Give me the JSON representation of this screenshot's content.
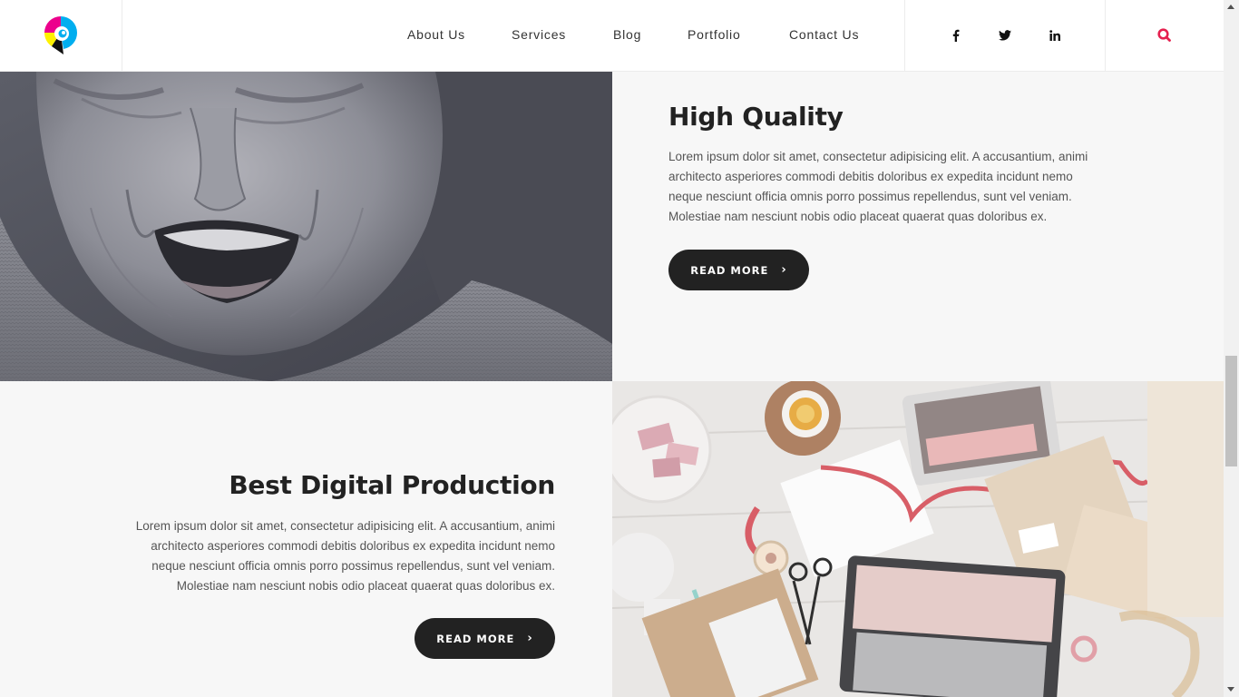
{
  "nav": {
    "items": [
      {
        "label": "About Us"
      },
      {
        "label": "Services"
      },
      {
        "label": "Blog"
      },
      {
        "label": "Portfolio"
      },
      {
        "label": "Contact Us"
      }
    ]
  },
  "social": {
    "facebook": "f",
    "twitter": "twitter-icon",
    "linkedin": "in"
  },
  "accent_color": "#e5204f",
  "sections": {
    "high_quality": {
      "title": "High Quality",
      "line1": "Lorem ipsum dolor sit amet, consectetur adipisicing elit. A accusantium, animi",
      "line2": "architecto asperiores commodi debitis doloribus ex expedita incidunt nemo",
      "line3": "neque nesciunt officia omnis porro possimus repellendus, sunt vel veniam.",
      "line4": "Molestiae nam nesciunt nobis odio placeat quaerat quas doloribus ex.",
      "button": "READ MORE"
    },
    "digital_production": {
      "title": "Best Digital Production",
      "line1": "Lorem ipsum dolor sit amet, consectetur adipisicing elit. A accusantium, animi",
      "line2": "architecto asperiores commodi debitis doloribus ex expedita incidunt nemo",
      "line3": "neque nesciunt officia omnis porro possimus repellendus, sunt vel veniam.",
      "line4": "Molestiae nam nesciunt nobis odio placeat quaerat quas doloribus ex.",
      "button": "READ MORE"
    }
  }
}
